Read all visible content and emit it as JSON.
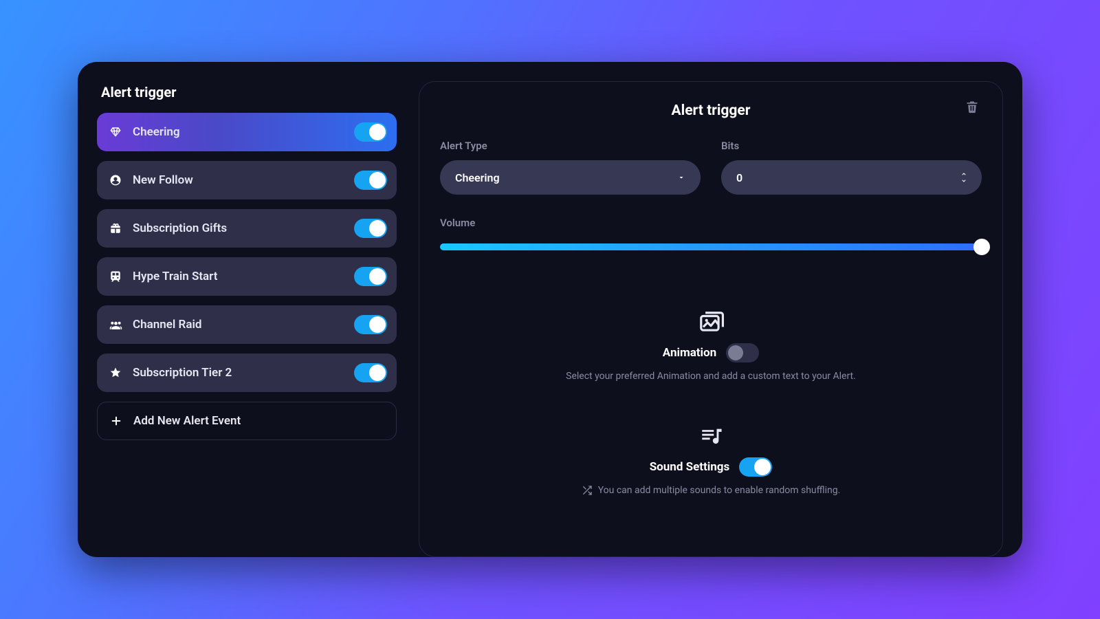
{
  "sidebar": {
    "title": "Alert trigger",
    "items": [
      {
        "icon": "diamond",
        "label": "Cheering",
        "active": true,
        "enabled": true
      },
      {
        "icon": "user-circle",
        "label": "New Follow",
        "active": false,
        "enabled": true
      },
      {
        "icon": "gift",
        "label": "Subscription Gifts",
        "active": false,
        "enabled": true
      },
      {
        "icon": "train",
        "label": "Hype Train Start",
        "active": false,
        "enabled": true
      },
      {
        "icon": "users",
        "label": "Channel Raid",
        "active": false,
        "enabled": true
      },
      {
        "icon": "star",
        "label": "Subscription Tier 2",
        "active": false,
        "enabled": true
      }
    ],
    "add_label": "Add New Alert Event"
  },
  "main": {
    "title": "Alert trigger",
    "alert_type": {
      "label": "Alert Type",
      "value": "Cheering"
    },
    "bits": {
      "label": "Bits",
      "value": "0"
    },
    "volume": {
      "label": "Volume",
      "value": 100
    },
    "animation": {
      "title": "Animation",
      "enabled": false,
      "description": "Select your preferred Animation and add a custom text to your Alert."
    },
    "sound": {
      "title": "Sound Settings",
      "enabled": true,
      "description": "You can add multiple sounds to enable random shuffling."
    }
  },
  "colors": {
    "accent_gradient_start": "#18c8ff",
    "accent_gradient_end": "#2f6dff",
    "panel_bg": "#0e0f1d",
    "pill_bg": "#373854",
    "item_bg": "#2f2f49",
    "toggle_on": "#16a3f2"
  }
}
